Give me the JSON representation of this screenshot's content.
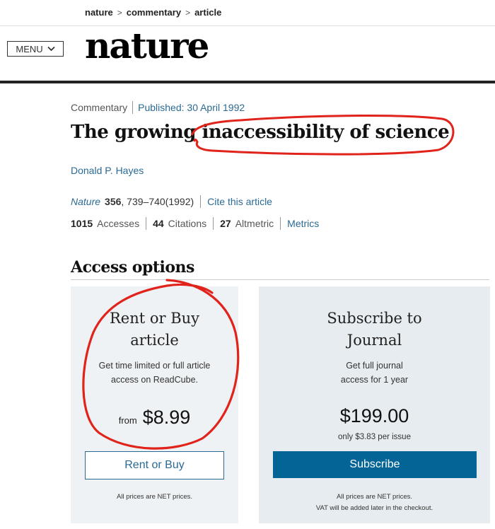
{
  "breadcrumb": {
    "items": [
      "nature",
      "commentary",
      "article"
    ],
    "separator": ">"
  },
  "header": {
    "menu_label": "MENU",
    "menu_icon": "chevron-down-icon",
    "logo": "nature"
  },
  "article": {
    "type": "Commentary",
    "published": "Published: 30 April 1992",
    "title": "The growing inaccessibility of science",
    "author": "Donald P. Hayes",
    "citation": {
      "journal": "Nature",
      "volume": "356",
      "pages": ", 739–740(1992)",
      "cite_link": "Cite this article"
    },
    "metrics": {
      "accesses": {
        "value": "1015",
        "label": "Accesses"
      },
      "citations": {
        "value": "44",
        "label": "Citations"
      },
      "altmetric": {
        "value": "27",
        "label": "Altmetric"
      },
      "metrics_link": "Metrics"
    }
  },
  "access_options": {
    "heading": "Access options",
    "rent": {
      "title_line1": "Rent or Buy",
      "title_line2": "article",
      "desc_line1": "Get time limited or full article",
      "desc_line2": "access on ReadCube.",
      "from_label": "from",
      "price": "$8.99",
      "button": "Rent or Buy",
      "note": "All prices are NET prices."
    },
    "subscribe": {
      "title_line1": "Subscribe to",
      "title_line2": "Journal",
      "desc_line1": "Get full journal",
      "desc_line2": "access for 1 year",
      "price": "$199.00",
      "per_issue": "only $3.83 per issue",
      "button": "Subscribe",
      "note_line1": "All prices are NET prices.",
      "note_line2": "VAT will be added later in the checkout."
    }
  },
  "colors": {
    "link": "#2a6a94",
    "primary_button": "#046496",
    "annotation": "#e0231b",
    "card_bg": "#eef2f4"
  }
}
